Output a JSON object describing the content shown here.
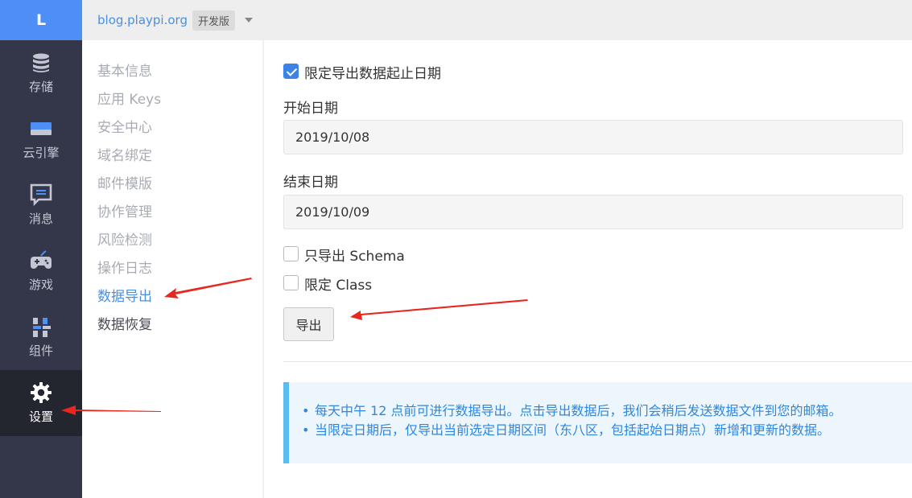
{
  "sidebar": {
    "logo": "L",
    "items": [
      {
        "label": "存储",
        "icon": "database-icon"
      },
      {
        "label": "云引擎",
        "icon": "server-icon"
      },
      {
        "label": "消息",
        "icon": "message-icon"
      },
      {
        "label": "游戏",
        "icon": "gamepad-icon"
      },
      {
        "label": "组件",
        "icon": "components-icon"
      },
      {
        "label": "设置",
        "icon": "gear-icon",
        "active": true
      }
    ]
  },
  "header": {
    "app_name": "blog.playpi.org",
    "badge": "开发版"
  },
  "submenu": {
    "items": [
      {
        "label": "基本信息"
      },
      {
        "label": "应用 Keys"
      },
      {
        "label": "安全中心"
      },
      {
        "label": "域名绑定"
      },
      {
        "label": "邮件模版"
      },
      {
        "label": "协作管理"
      },
      {
        "label": "风险检测"
      },
      {
        "label": "操作日志"
      },
      {
        "label": "数据导出",
        "active": true
      },
      {
        "label": "数据恢复"
      }
    ]
  },
  "form": {
    "limit_date_label": "限定导出数据起止日期",
    "limit_date_checked": true,
    "start_label": "开始日期",
    "start_value": "2019/10/08",
    "end_label": "结束日期",
    "end_value": "2019/10/09",
    "schema_only_label": "只导出 Schema",
    "limit_class_label": "限定 Class",
    "export_button": "导出"
  },
  "notice": {
    "lines": [
      "每天中午 12 点前可进行数据导出。点击导出数据后，我们会稍后发送数据文件到您的邮箱。",
      "当限定日期后，仅导出当前选定日期区间（东八区，包括起始日期点）新增和更新的数据。"
    ]
  },
  "colors": {
    "accent": "#4a8fe0",
    "sidebar_bg": "#34374a",
    "annotation_arrow": "#e8281e"
  }
}
